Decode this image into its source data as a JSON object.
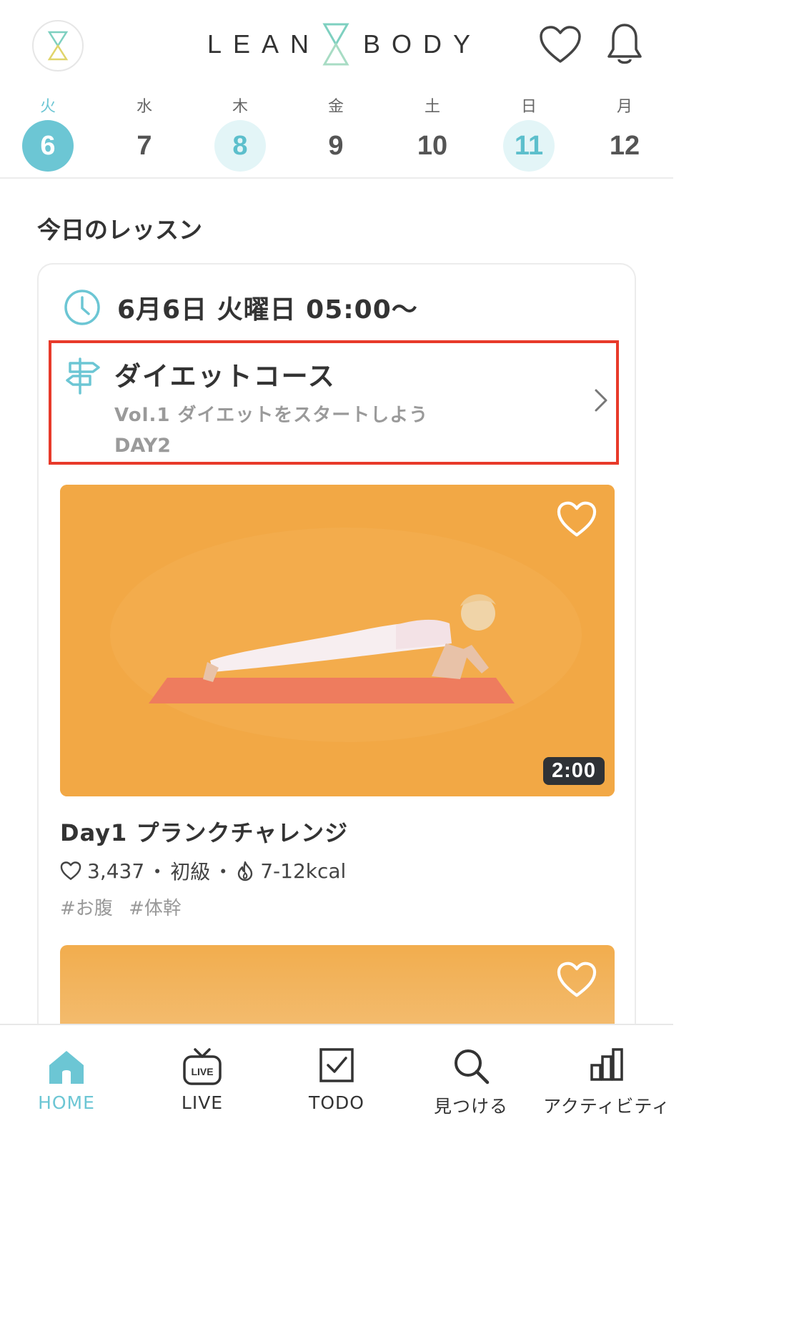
{
  "app": {
    "brand_left": "LEAN",
    "brand_right": "BODY",
    "accent_color": "#6cc6d4",
    "highlight_color": "#e83a2a"
  },
  "header": {
    "icons": [
      "hourglass-logo-icon",
      "heart-icon",
      "bell-icon"
    ]
  },
  "dates": [
    {
      "dow": "火",
      "num": "6",
      "state": "today"
    },
    {
      "dow": "水",
      "num": "7",
      "state": "normal"
    },
    {
      "dow": "木",
      "num": "8",
      "state": "marked"
    },
    {
      "dow": "金",
      "num": "9",
      "state": "normal"
    },
    {
      "dow": "土",
      "num": "10",
      "state": "normal"
    },
    {
      "dow": "日",
      "num": "11",
      "state": "marked"
    },
    {
      "dow": "月",
      "num": "12",
      "state": "normal"
    }
  ],
  "section": {
    "title": "今日のレッスン"
  },
  "schedule": {
    "text": "6月6日 火曜日 05:00〜"
  },
  "course": {
    "title": "ダイエットコース",
    "subtitle": "Vol.1 ダイエットをスタートしよう",
    "day": "DAY2"
  },
  "lesson": {
    "duration": "2:00",
    "title": "Day1 プランクチャレンジ",
    "likes": "3,437",
    "level": "初級",
    "calories": "7-12kcal",
    "separator": "・",
    "tags": [
      "#お腹",
      "#体幹"
    ]
  },
  "bottom_nav": [
    {
      "label": "HOME",
      "icon": "home-icon",
      "active": true
    },
    {
      "label": "LIVE",
      "icon": "live-tv-icon",
      "active": false
    },
    {
      "label": "TODO",
      "icon": "checkbox-icon",
      "active": false
    },
    {
      "label": "見つける",
      "icon": "search-icon",
      "active": false
    },
    {
      "label": "アクティビティ",
      "icon": "bar-chart-icon",
      "active": false
    }
  ]
}
